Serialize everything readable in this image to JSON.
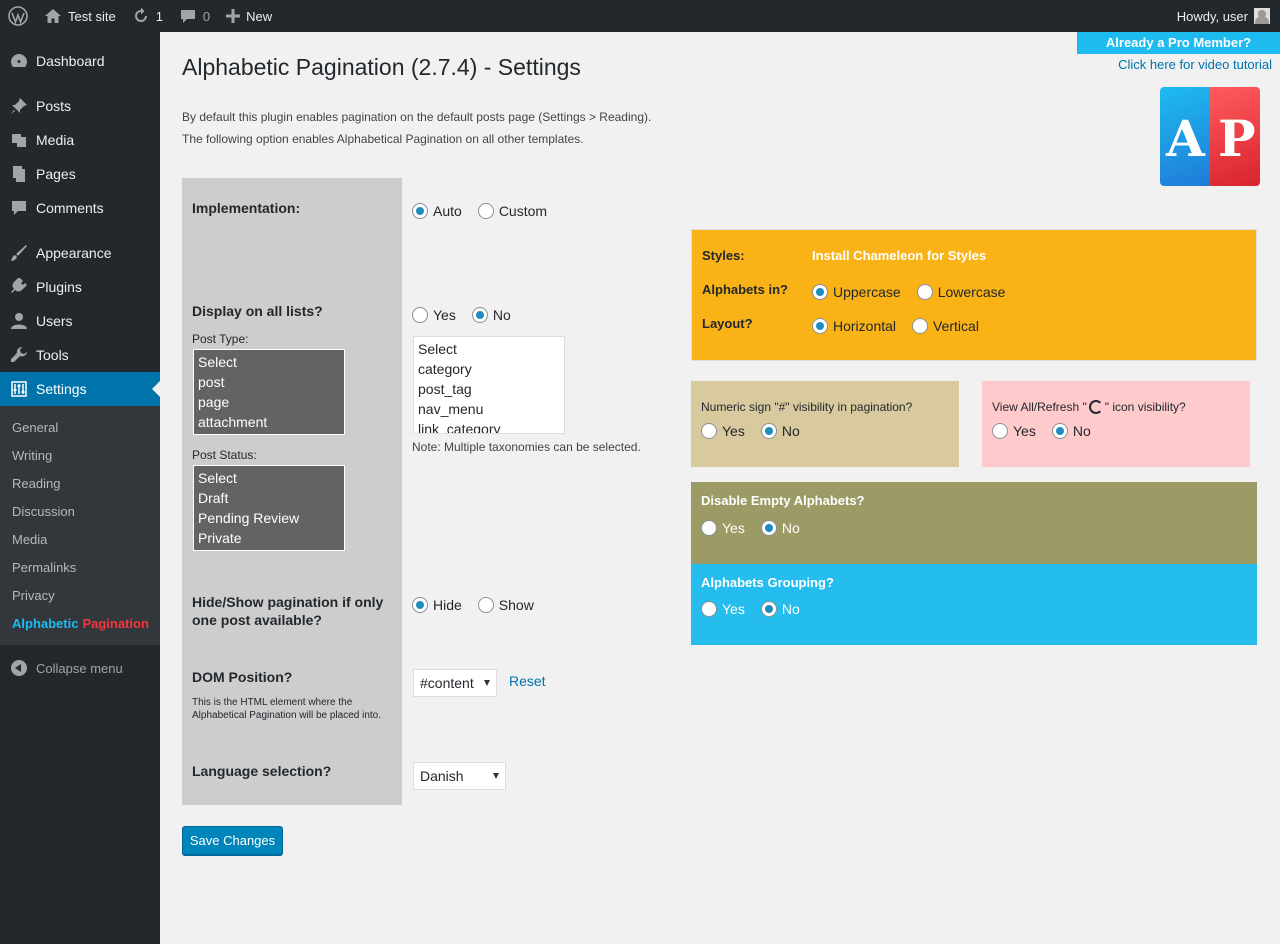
{
  "admin_bar": {
    "site_name": "Test site",
    "updates_count": "1",
    "comments_count": "0",
    "new_label": "New",
    "greeting": "Howdy, user"
  },
  "sidebar": {
    "items": [
      {
        "label": "Dashboard",
        "icon": "dashboard-icon"
      },
      {
        "label": "Posts",
        "icon": "pin-icon"
      },
      {
        "label": "Media",
        "icon": "media-icon"
      },
      {
        "label": "Pages",
        "icon": "pages-icon"
      },
      {
        "label": "Comments",
        "icon": "comment-icon"
      },
      {
        "label": "Appearance",
        "icon": "brush-icon"
      },
      {
        "label": "Plugins",
        "icon": "plug-icon"
      },
      {
        "label": "Users",
        "icon": "user-icon"
      },
      {
        "label": "Tools",
        "icon": "wrench-icon"
      },
      {
        "label": "Settings",
        "icon": "sliders-icon"
      }
    ],
    "settings_submenu": [
      "General",
      "Writing",
      "Reading",
      "Discussion",
      "Media",
      "Permalinks",
      "Privacy"
    ],
    "plugin_submenu": {
      "part1": "Alphabetic",
      "part2": "Pagination"
    },
    "collapse_label": "Collapse menu"
  },
  "header": {
    "title": "Alphabetic Pagination (2.7.4) - Settings",
    "pro_member": "Already a Pro Member?",
    "video_link": "Click here for video tutorial",
    "intro_line1": "By default this plugin enables pagination on the default posts page (Settings > Reading).",
    "intro_line2": "The following option enables Alphabetical Pagination on all other templates.",
    "logo_letters": [
      "A",
      "P"
    ]
  },
  "form": {
    "implementation": {
      "label": "Implementation:",
      "options": [
        "Auto",
        "Custom"
      ],
      "selected": "Auto"
    },
    "display_all": {
      "label": "Display on all lists?",
      "options": [
        "Yes",
        "No"
      ],
      "selected": "No"
    },
    "post_type": {
      "label": "Post Type:",
      "items": [
        "Select",
        "post",
        "page",
        "attachment"
      ]
    },
    "taxonomies": {
      "items": [
        "Select",
        "category",
        "post_tag",
        "nav_menu",
        "link_category"
      ],
      "note": "Note: Multiple taxonomies can be selected."
    },
    "post_status": {
      "label": "Post Status:",
      "items": [
        "Select",
        "Draft",
        "Pending Review",
        "Private"
      ]
    },
    "hide_show": {
      "label_line1": "Hide/Show pagination if only",
      "label_line2": "one post available?",
      "options": [
        "Hide",
        "Show"
      ],
      "selected": "Hide"
    },
    "dom_position": {
      "label": "DOM Position?",
      "help1": "This is the HTML element where the",
      "help2": "Alphabetical Pagination will be placed into.",
      "value": "#content",
      "reset": "Reset"
    },
    "language": {
      "label": "Language selection?",
      "value": "Danish"
    },
    "save_label": "Save Changes"
  },
  "panels": {
    "styles": {
      "label": "Styles:",
      "link": "Install Chameleon for Styles"
    },
    "alphabets_in": {
      "label": "Alphabets in?",
      "options": [
        "Uppercase",
        "Lowercase"
      ],
      "selected": "Uppercase"
    },
    "layout": {
      "label": "Layout?",
      "options": [
        "Horizontal",
        "Vertical"
      ],
      "selected": "Horizontal"
    },
    "numeric": {
      "label": "Numeric sign \"#\" visibility in pagination?",
      "options": [
        "Yes",
        "No"
      ],
      "selected": "No"
    },
    "view_all": {
      "label_pre": "View All/Refresh \"",
      "label_post": "\" icon visibility?",
      "options": [
        "Yes",
        "No"
      ],
      "selected": "No"
    },
    "disable_empty": {
      "label": "Disable Empty Alphabets?",
      "options": [
        "Yes",
        "No"
      ],
      "selected": "No"
    },
    "grouping": {
      "label": "Alphabets Grouping?",
      "options": [
        "Yes",
        "No"
      ],
      "selected": "No"
    }
  },
  "colors": {
    "admin_dark": "#23282d",
    "accent_blue": "#0073aa",
    "styles_panel": "#f9b317",
    "numeric_panel": "#d8ca9e",
    "viewall_panel": "#ffcacb",
    "disable_panel": "#9c9a65",
    "grouping_panel": "#25bdee"
  }
}
